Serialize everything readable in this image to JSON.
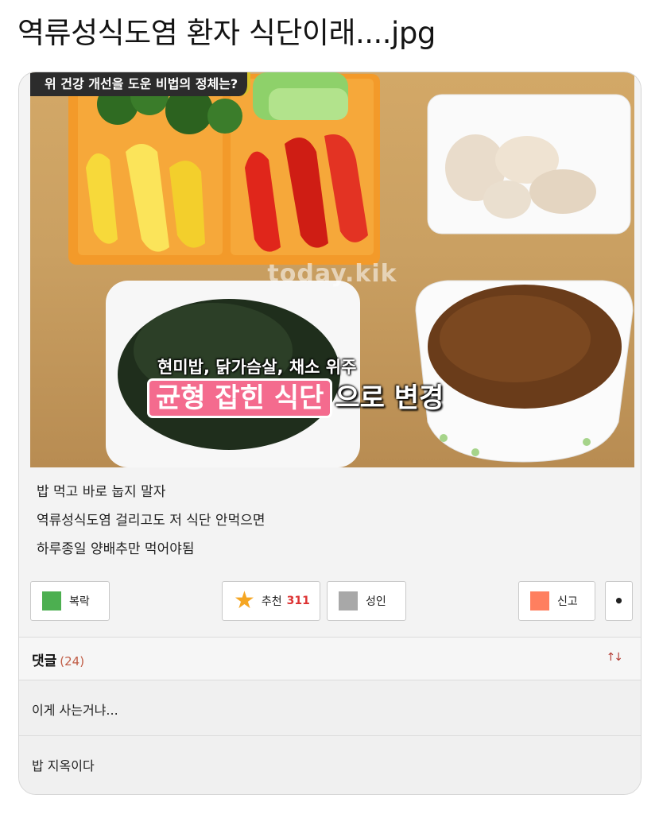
{
  "title": "역류성식도염 환자 식단이래....jpg",
  "image": {
    "banner": "위 건강 개선을 도운 비법의 정체는?",
    "watermark": "today.kik",
    "caption_line1": "현미밥, 닭가슴살, 채소 위주",
    "caption_highlight": "균형 잡힌 식단",
    "caption_rest": "으로 변경"
  },
  "post": {
    "lines": [
      "밥 먹고 바로 눕지 말자",
      "역류성식도염 걸리고도 저 식단 안먹으면",
      "하루종일 양배추만 먹어야됨"
    ]
  },
  "actions": {
    "scrap": {
      "label": "복락",
      "color": "#4caf50"
    },
    "recommend": {
      "label": "추천",
      "count": "311",
      "color": "#f5a623"
    },
    "adult": {
      "label": "성인",
      "color": "#a8a8a8"
    },
    "report": {
      "label": "신고",
      "color": "#ff7f5f"
    },
    "more": {
      "label": "•"
    }
  },
  "comments": {
    "title": "댓글",
    "count": "(24)",
    "sort_icon": "sort-arrows-icon",
    "items": [
      {
        "text": "이게 사는거냐..."
      },
      {
        "text": "밥 지옥이다"
      }
    ]
  }
}
